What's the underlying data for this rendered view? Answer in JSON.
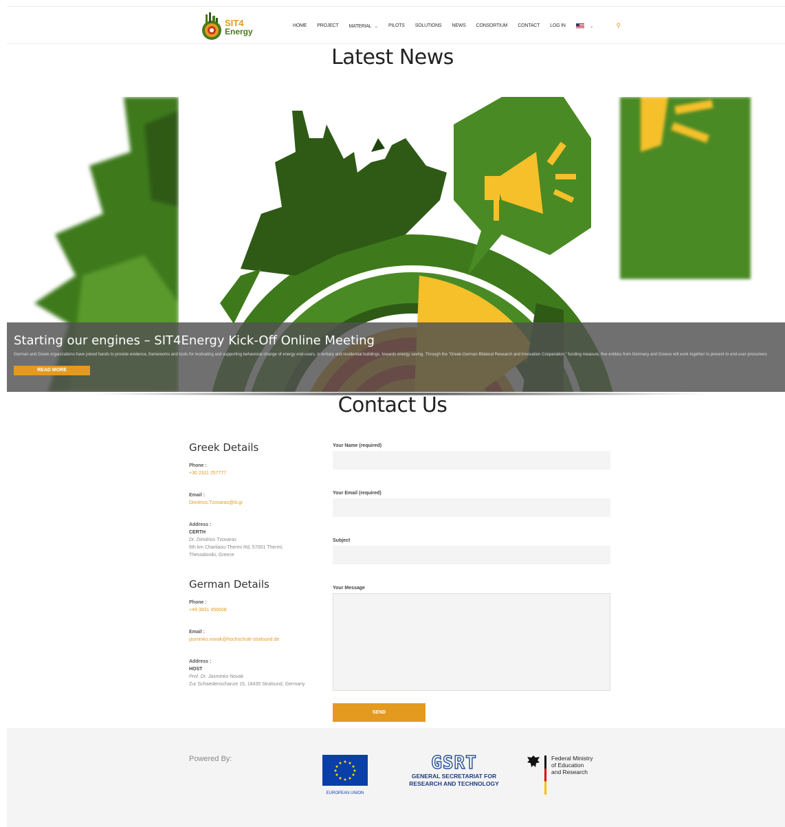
{
  "header": {
    "logo_primary": "SIT4",
    "logo_secondary": "Energy",
    "nav": [
      {
        "label": "HOME",
        "dropdown": false
      },
      {
        "label": "PROJECT",
        "dropdown": false
      },
      {
        "label": "MATERIAL",
        "dropdown": true
      },
      {
        "label": "PILOTS",
        "dropdown": false
      },
      {
        "label": "SOLUTIONS",
        "dropdown": false
      },
      {
        "label": "NEWS",
        "dropdown": false
      },
      {
        "label": "CONSORTIUM",
        "dropdown": false
      },
      {
        "label": "CONTACT",
        "dropdown": false
      },
      {
        "label": "LOG IN",
        "dropdown": false
      }
    ],
    "chevron": "⌄",
    "search_glyph": "⚲"
  },
  "news": {
    "title": "Latest News",
    "slide": {
      "title": "Starting our engines – SIT4Energy Kick-Off Online Meeting",
      "text": "German and Greek organizations have joined hands to provide evidence, frameworks and tools for motivating and supporting behavioral change of energy end-users, in tertiary and residential buildings, towards energy saving. Through the \"Greek-German Bilateral Research and Innovation Cooperation \" funding measure, five entities from Germany and Greece will work together to present to end-user prosumers",
      "button": "READ MORE"
    }
  },
  "contact": {
    "title": "Contact Us",
    "greek": {
      "heading": "Greek Details",
      "phone_label": "Phone :",
      "phone": "+30 2311 257777",
      "email_label": "Email :",
      "email": "Dimitrios.Tzovaras@iti.gr",
      "address_label": "Address :",
      "org": "CERTH",
      "person": "Dr. Dimitrios Tzovaras",
      "address_line1": "6th km Charilaou-Thermi Rd, 57001 Thermi,",
      "address_line2": "Thessaloniki, Greece"
    },
    "german": {
      "heading": "German Details",
      "phone_label": "Phone :",
      "phone": "+49 3831 456608",
      "email_label": "Email :",
      "email": "jasminko.novak@hochschule-stralsund.de",
      "address_label": "Address :",
      "org": "HOST",
      "person": "Prof. Dr. Jasminko Novak",
      "address_line1": "Zur Schwedenschanze 15, 18435 Stralsund, Germany"
    },
    "form": {
      "name_label": "Your Name (required)",
      "email_label": "Your Email (required)",
      "subject_label": "Subject",
      "message_label": "Your Message",
      "name_value": "",
      "email_value": "",
      "subject_value": "",
      "message_value": "",
      "send": "SEND"
    }
  },
  "footer": {
    "powered_by": "Powered By:",
    "eu_label": "EUROPEAN UNION",
    "gsrt_logo": "GSRT",
    "gsrt_line1": "GENERAL SECRETARIAT FOR",
    "gsrt_line2": "RESEARCH AND TECHNOLOGY",
    "bmbf_line1": "Federal Ministry",
    "bmbf_line2": "of Education",
    "bmbf_line3": "and Research"
  },
  "colors": {
    "accent": "#e49a1f",
    "green_dark": "#2e5a16",
    "green": "#4a8a24",
    "yellow": "#f5c02a",
    "red": "#c7361c"
  },
  "icons": {
    "search": "search-icon",
    "flag": "us-flag-icon",
    "megaphone": "megaphone-icon"
  }
}
